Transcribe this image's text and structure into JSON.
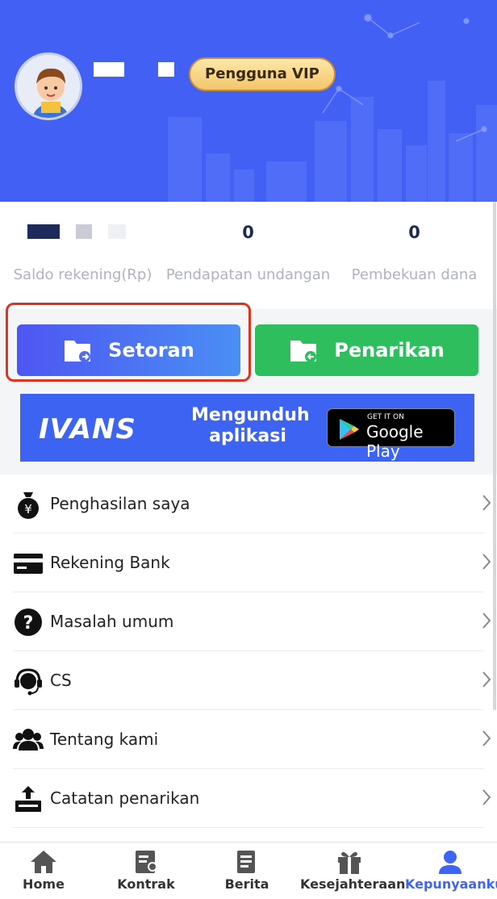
{
  "profile": {
    "vip_label": "Pengguna VIP"
  },
  "stats": [
    {
      "value": "",
      "label": "Saldo rekening(Rp)"
    },
    {
      "value": "0",
      "label": "Pendapatan undangan"
    },
    {
      "value": "0",
      "label": "Pembekuan dana"
    }
  ],
  "actions": {
    "deposit_label": "Setoran",
    "withdraw_label": "Penarikan"
  },
  "banner": {
    "brand": "IVANS",
    "cta": "Mengunduh aplikasi",
    "store_small": "GET IT ON",
    "store_big": "Google Play"
  },
  "menu": {
    "items": [
      {
        "label": "Penghasilan saya",
        "icon": "money-bag-icon"
      },
      {
        "label": "Rekening Bank",
        "icon": "bank-card-icon"
      },
      {
        "label": "Masalah umum",
        "icon": "question-icon"
      },
      {
        "label": "CS",
        "icon": "headset-icon"
      },
      {
        "label": "Tentang kami",
        "icon": "users-icon"
      },
      {
        "label": "Catatan penarikan",
        "icon": "withdraw-record-icon"
      }
    ]
  },
  "tabs": [
    {
      "label": "Home",
      "icon": "home-icon"
    },
    {
      "label": "Kontrak",
      "icon": "contract-icon"
    },
    {
      "label": "Berita",
      "icon": "news-icon"
    },
    {
      "label": "Kesejahteraan",
      "icon": "gift-icon"
    },
    {
      "label": "Kepunyaanku",
      "icon": "user-icon",
      "active": true
    }
  ],
  "colors": {
    "header_bg": "#4360f5",
    "deposit_btn": "#4e56f2",
    "withdraw_btn": "#2fbe5d",
    "highlight": "#e0321f",
    "active_tab": "#3f63f4"
  }
}
